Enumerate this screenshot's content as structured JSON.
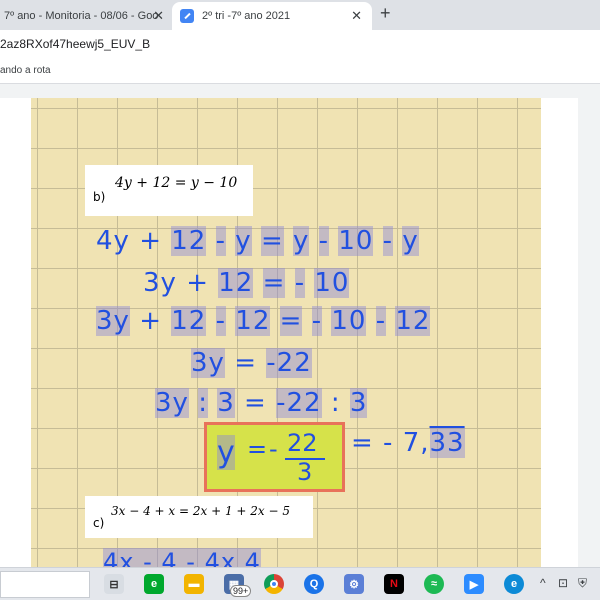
{
  "tabs": [
    {
      "title": "7º ano - Monitoria - 08/06 - Goo",
      "close": "✕"
    },
    {
      "title": "2º tri -7º ano 2021",
      "close": "✕"
    }
  ],
  "new_tab": "+",
  "address": {
    "url": "2az8RXof47heewj5_EUV_B"
  },
  "bookmark": {
    "label": "ando a rota"
  },
  "problem_b": {
    "label": "b)",
    "equation": "4y + 12 = y − 10"
  },
  "problem_c": {
    "label": "c)",
    "equation": "3x − 4 + x = 2x + 1 + 2x − 5"
  },
  "handwriting": {
    "line1": [
      "4y",
      "+",
      "12",
      "-",
      "y",
      "=",
      "y",
      "-",
      "10",
      "-",
      "y"
    ],
    "line2": [
      "3y",
      "+",
      "12",
      "=",
      "-",
      "10"
    ],
    "line3": [
      "3y",
      "+",
      "12",
      "-",
      "12",
      "=",
      "-",
      "10",
      "-",
      "12"
    ],
    "line4": [
      "3y",
      "=",
      "-22"
    ],
    "line5": [
      "3y",
      ":",
      "3",
      "=",
      "-22",
      ":",
      "3"
    ],
    "answer_var": "y",
    "answer_eq": "=",
    "answer_sign": "-",
    "answer_num": "22",
    "answer_den": "3",
    "approx": "= - 7,",
    "repeating": "33",
    "line6_partial": "4x  - 4 - 4x  4"
  },
  "taskbar": {
    "badge": "99+",
    "tray_icons": [
      "chevron-up-icon",
      "network-icon",
      "shield-icon"
    ]
  },
  "colors": {
    "ink": "#2150e0",
    "paper": "#f0e3b3",
    "highlight": "#d6e24a",
    "answer_border": "#e8725a"
  }
}
